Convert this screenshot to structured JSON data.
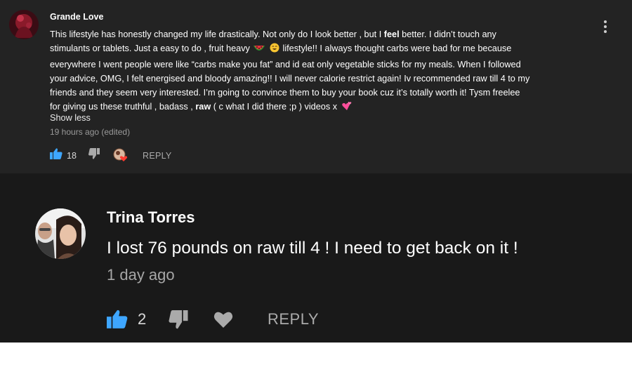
{
  "comment1": {
    "author": "Grande Love",
    "text_lines": [
      [
        "This lifestyle has honestly changed my life drastically. Not only do I look better , but I ",
        "feel",
        " better. I didn’t touch any"
      ],
      [
        "stimulants or tablets. Just a easy to do , fruit heavy ",
        "watermelon-emoji",
        " ",
        "grin-emoji",
        " lifestyle!! I always thought carbs were bad for me because"
      ],
      [
        "everywhere I went people were like “carbs make you fat” and id eat only vegetable sticks for my meals. When I followed"
      ],
      [
        "your advice, OMG, I felt energised and bloody amazing!! I will never calorie restrict again! Iv recommended raw till 4 to my"
      ],
      [
        "friends and they seem very interested. I’m going to convince them to buy your book cuz it’s totally worth it! Tysm freelee"
      ],
      [
        "for giving us these truthful , badass , ",
        "raw",
        " ( c what I did there ;p ) videos x ",
        "hearts-emoji"
      ]
    ],
    "show_less": "Show less",
    "timestamp": "19 hours ago (edited)",
    "likes": "18",
    "reply_label": "REPLY",
    "accent_color": "#3ea6ff"
  },
  "comment2": {
    "author": "Trina Torres",
    "text": "I lost 76 pounds on raw till 4 ! I need to get back on it !",
    "timestamp": "1 day ago",
    "likes": "2",
    "reply_label": "REPLY",
    "accent_color": "#3ea6ff"
  }
}
